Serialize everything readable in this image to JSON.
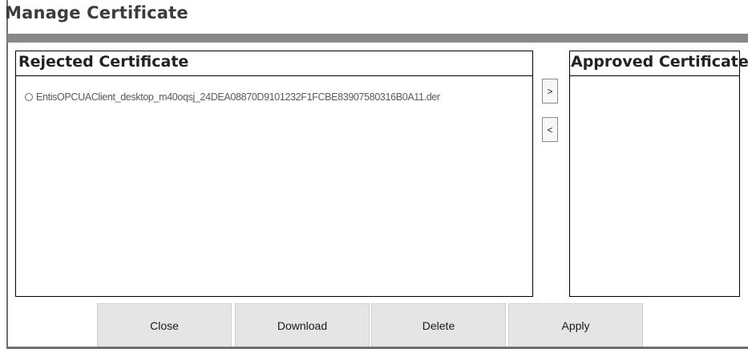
{
  "dialog": {
    "title": "Manage Certificate"
  },
  "rejected": {
    "title": "Rejected Certificate",
    "items": [
      {
        "label": "EntisOPCUAClient_desktop_m40oqsj_24DEA08870D9101232F1FCBE83907580316B0A11.der",
        "selected": false
      }
    ]
  },
  "approved": {
    "title": "Approved Certificate",
    "items": []
  },
  "transfer": {
    "approve_label": ">",
    "reject_label": "<"
  },
  "actions": {
    "close": "Close",
    "download": "Download",
    "delete": "Delete",
    "apply": "Apply"
  },
  "colors": {
    "title_rule": "#888888",
    "button_bg": "#e5e5e5",
    "panel_border": "#000000"
  }
}
